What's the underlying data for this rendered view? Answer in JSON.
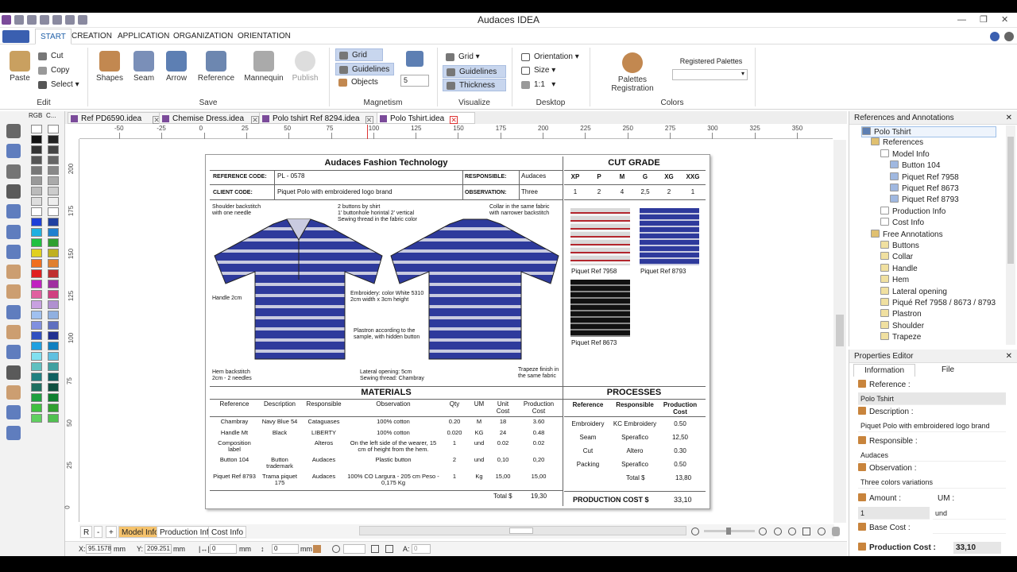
{
  "app": {
    "title": "Audaces IDEA"
  },
  "ribbon_tabs": [
    "START",
    "CREATION",
    "APPLICATION",
    "ORGANIZATION",
    "ORIENTATION"
  ],
  "edit": {
    "paste": "Paste",
    "cut": "Cut",
    "copy": "Copy",
    "select": "Select",
    "label": "Edit"
  },
  "save_group": {
    "items": [
      "Shapes",
      "Seam",
      "Arrow",
      "Reference",
      "Mannequin",
      "Publish"
    ],
    "label": "Save"
  },
  "magnetism": {
    "grid": "Grid",
    "guidelines": "Guidelines",
    "objects": "Objects",
    "value": "5",
    "label": "Magnetism"
  },
  "visualize": {
    "grid": "Grid",
    "guidelines": "Guidelines",
    "thickness": "Thickness",
    "label": "Visualize"
  },
  "desktop": {
    "orientation": "Orientation",
    "size": "Size",
    "ratio": "1:1",
    "label": "Desktop"
  },
  "colors": {
    "palettes_registration": "Palettes Registration",
    "registered_palettes": "Registered Palettes",
    "label": "Colors"
  },
  "palette_header": {
    "rgb": "RGB",
    "c": "C..."
  },
  "doc_tabs": [
    "Ref PD6590.idea",
    "Chemise Dress.idea",
    "Polo tshirt Ref 8294.idea",
    "Polo Tshirt.idea"
  ],
  "ruler_h": [
    "-50",
    "-25",
    "0",
    "25",
    "50",
    "75",
    "100",
    "125",
    "150",
    "175",
    "200",
    "225",
    "250",
    "275",
    "300",
    "325",
    "350"
  ],
  "ruler_v": [
    "200",
    "175",
    "150",
    "125",
    "100",
    "75",
    "50",
    "25",
    "0"
  ],
  "sheet": {
    "title": "Audaces Fashion Technology",
    "ref_code_label": "REFERENCE CODE:",
    "ref_code": "PL - 0578",
    "responsible_label": "RESPONSIBLE:",
    "responsible": "Audaces",
    "client_code_label": "CLIENT CODE:",
    "client_code": "Piquet Polo with embroidered logo brand",
    "observation_label": "OBSERVATION:",
    "observation": "Three",
    "cut_grade": {
      "title": "CUT GRADE",
      "sizes": [
        "XP",
        "P",
        "M",
        "G",
        "XG",
        "XXG"
      ],
      "values": [
        "1",
        "2",
        "4",
        "2,5",
        "2",
        "1"
      ]
    },
    "annotations": {
      "shoulder": "Shoulder backstitch\nwith one needle",
      "buttons": "2 buttons by shirt\n1' buttonhole horintal 2' vertical\nSewing thread in the fabric color",
      "collar": "Collar in the same fabric\nwith narrower backstitch",
      "handle": "Handle 2cm",
      "embroidery": "Embroidery: color White 5310\n2cm width x 3cm height",
      "plastron": "Plastron according to the\nsample, with hidden button",
      "hem": "Hem backstitch\n2cm - 2 needles",
      "lateral": "Lateral opening: 5cm\nSewing thread: Chambray",
      "trapeze": "Trapeze finish in\nthe same fabric"
    },
    "fabrics": [
      "Piquet Ref 7958",
      "Piquet Ref 8793",
      "Piquet Ref 8673"
    ],
    "materials": {
      "title": "MATERIALS",
      "headers": [
        "Reference",
        "Description",
        "Responsible",
        "Observation",
        "Qty",
        "UM",
        "Unit Cost",
        "Production Cost"
      ],
      "rows": [
        [
          "Chambray",
          "Navy Blue 54",
          "Cataguases",
          "100% cotton",
          "0.20",
          "M",
          "18",
          "3.60"
        ],
        [
          "Handle Mt",
          "Black",
          "LIBERTY",
          "100% cotton",
          "0.020",
          "KG",
          "24",
          "0.48"
        ],
        [
          "Composition label",
          "",
          "Alteros",
          "On the left side of the wearer, 15 cm of height from the hem.",
          "1",
          "und",
          "0.02",
          "0.02"
        ],
        [
          "Button 104",
          "Button trademark",
          "Audaces",
          "Plastic button",
          "2",
          "und",
          "0,10",
          "0,20"
        ],
        [
          "Piquet Ref 8793",
          "Trama piquet 175",
          "Audaces",
          "100% CO Largura - 205 cm Peso - 0,175 Kg",
          "1",
          "Kg",
          "15,00",
          "15,00"
        ]
      ],
      "total_label": "Total $",
      "total": "19,30"
    },
    "processes": {
      "title": "PROCESSES",
      "headers": [
        "Reference",
        "Responsible",
        "Production Cost"
      ],
      "rows": [
        [
          "Embroidery",
          "KC Embroidery",
          "0.50"
        ],
        [
          "Seam",
          "Sperafico",
          "12,50"
        ],
        [
          "Cut",
          "Altero",
          "0.30"
        ],
        [
          "Packing",
          "Sperafico",
          "0.50"
        ]
      ],
      "total_label": "Total $",
      "total": "13,80"
    },
    "production_cost_label": "PRODUCTION COST $",
    "production_cost": "33,10"
  },
  "bottom_tabs": [
    "R",
    "-",
    "+",
    "Model Info",
    "Production Info",
    "Cost Info"
  ],
  "status": {
    "x_label": "X:",
    "x": "95.1578",
    "x_unit": "mm",
    "y_label": "Y:",
    "y": "209.251",
    "y_unit": "mm",
    "w": "0",
    "w_unit": "mm",
    "h": "0",
    "h_unit": "mm",
    "a_label": "A:",
    "a": "0"
  },
  "ref_panel": {
    "title": "References and Annotations",
    "nodes": [
      "Polo Tshirt",
      "References",
      "Model Info",
      "Button 104",
      "Piquet Ref 7958",
      "Piquet Ref 8673",
      "Piquet Ref 8793",
      "Production Info",
      "Cost Info",
      "Free Annotations",
      "Buttons",
      "Collar",
      "Handle",
      "Hem",
      "Lateral opening",
      "Piqué Ref 7958 / 8673 / 8793: ...",
      "Plastron",
      "Shoulder",
      "Trapeze"
    ]
  },
  "props": {
    "title": "Properties Editor",
    "tabs": [
      "Information",
      "File"
    ],
    "reference_label": "Reference :",
    "reference": "Polo Tshirt",
    "description_label": "Description :",
    "description": "Piquet Polo with embroidered logo brand",
    "responsible_label": "Responsible :",
    "responsible": "Audaces",
    "observation_label": "Observation :",
    "observation": "Three colors variations",
    "amount_label": "Amount :",
    "um_label": "UM :",
    "amount": "1",
    "um": "und",
    "base_cost_label": "Base Cost :",
    "production_cost_label": "Production Cost :",
    "production_cost": "33,10"
  },
  "colors_hex": {
    "accent": "#1f5fa8",
    "shirt_blue": "#2e3a9c",
    "stripe": "#c9cbe0",
    "highlight": "#c8d6ee",
    "active_tab": "#f5c26b"
  }
}
